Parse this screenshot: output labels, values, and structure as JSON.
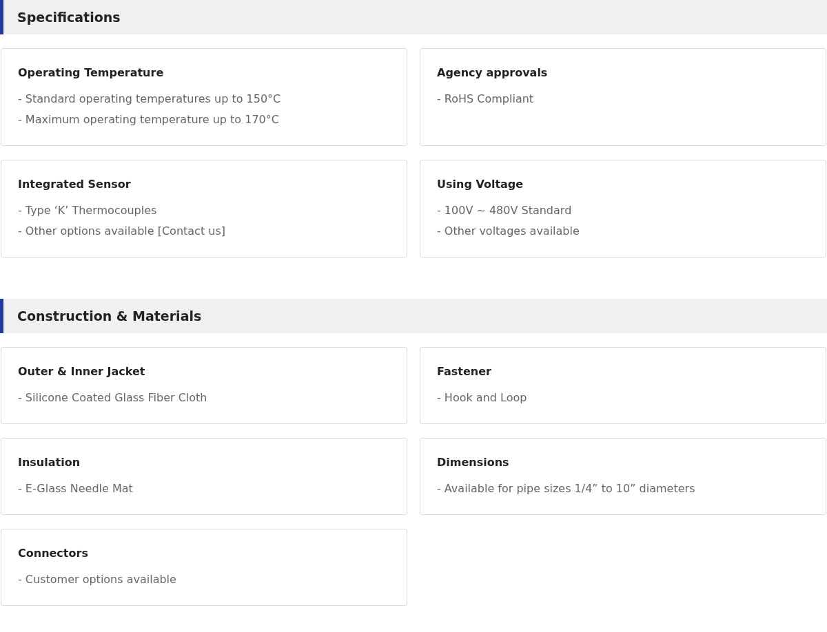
{
  "sections": [
    {
      "title": "Specifications",
      "cards": [
        {
          "title": "Operating Temperature",
          "lines": [
            "- Standard operating temperatures up to 150°C",
            "- Maximum operating temperature up to 170°C"
          ]
        },
        {
          "title": "Agency approvals",
          "lines": [
            "- RoHS Compliant"
          ]
        },
        {
          "title": "Integrated Sensor",
          "lines": [
            "- Type ‘K’ Thermocouples",
            "- Other options available [Contact us]"
          ]
        },
        {
          "title": "Using Voltage",
          "lines": [
            "- 100V ~ 480V Standard",
            "- Other voltages available"
          ]
        }
      ]
    },
    {
      "title": "Construction & Materials",
      "cards": [
        {
          "title": "Outer & Inner Jacket",
          "lines": [
            "- Silicone Coated Glass Fiber Cloth"
          ]
        },
        {
          "title": "Fastener",
          "lines": [
            "- Hook and Loop"
          ]
        },
        {
          "title": "Insulation",
          "lines": [
            "- E-Glass Needle Mat"
          ]
        },
        {
          "title": "Dimensions",
          "lines": [
            "- Available for pipe sizes 1/4” to 10” diameters"
          ]
        },
        {
          "title": "Connectors",
          "lines": [
            "- Customer options available"
          ]
        }
      ]
    }
  ]
}
